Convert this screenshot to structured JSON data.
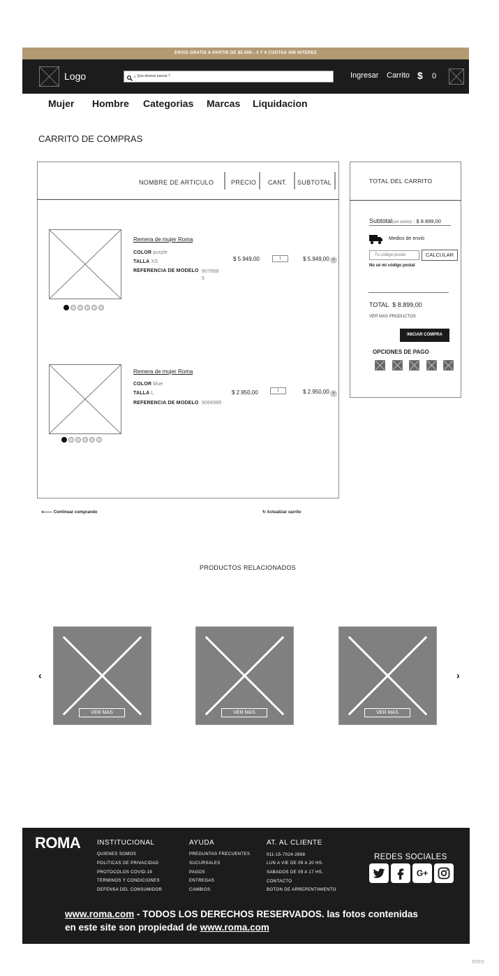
{
  "promo_bar": {
    "text": "ENVIO GRATIS A PARTIR DE $5.000.- 3 Y 6 CUOTAS SIN INTERES"
  },
  "header": {
    "logo_label": "Logo",
    "search_placeholder": "¿ Que deseas buscar ?",
    "login_label": "Ingresar",
    "cart_label": "Carrito",
    "cart_currency": "$",
    "cart_count": "0"
  },
  "nav": {
    "items": [
      "Mujer",
      "Hombre",
      "Categorias",
      "Marcas",
      "Liquidacion"
    ]
  },
  "page_title": "CARRITO DE COMPRAS",
  "cart_table": {
    "columns": [
      "NOMBRE DE ARTICULO",
      "PRECIO",
      "CANT.",
      "SUBTOTAL"
    ],
    "items": [
      {
        "name": "Remera de mujer Roma",
        "color_label": "COLOR",
        "color_value": "purple",
        "size_label": "TALLA",
        "size_value": "XS",
        "ref_label": "REFERENCIA DE MODELO",
        "ref_value": "907668",
        "ref_value_2": "5",
        "price": "$ 5.949,00",
        "qty": "1",
        "subtotal": "$ 5.949,00"
      },
      {
        "name": "Remera de mujer Roma",
        "color_label": "COLOR",
        "color_value": "blue",
        "size_label": "TALLA",
        "size_value": "L",
        "ref_label": "REFERENCIA DE MODELO",
        "ref_value": "9066985",
        "price": "$ 2.950,00",
        "qty": "1",
        "subtotal": "$ 2.950,00"
      }
    ],
    "continue_label": "Continuar comprando",
    "update_label": "Actualizar carrito"
  },
  "cart_total": {
    "title": "TOTAL DEL CARRITO",
    "subtotal_label": "Subtotal",
    "subtotal_note": "(sin envío)",
    "subtotal_value": ": $ 8.899,00",
    "shipping_label": "Medios de envió",
    "postal_placeholder": "Tu código postal",
    "calc_label": "CALCULAR",
    "postal_help": "No sé mi código postal",
    "total_label": "TOTAL",
    "total_value": "$ 8.899,00",
    "more_products": "VER MAS PRODUCTOS",
    "checkout_label": "INICIAR COMPRA",
    "payment_title": "OPCIONES DE PAGO",
    "payment_icons": [
      "payment-icon-1",
      "payment-icon-2",
      "payment-icon-3",
      "payment-icon-4",
      "payment-icon-5"
    ]
  },
  "related": {
    "title": "PRODUCTOS RELACIONADOS",
    "cards": [
      {
        "button": "VER MAS"
      },
      {
        "button": "VER MAS"
      },
      {
        "button": "VER MAS"
      }
    ],
    "prev_icon": "‹",
    "next_icon": "›"
  },
  "footer": {
    "brand": "ROMA",
    "columns": [
      {
        "title": "INSTITUCIONAL",
        "links": [
          "QUIENES SOMOS",
          "POLITICAS DE PRIVACIDAD",
          "PROTOCOLOS COVID-19",
          "TERMINOS Y CONDICIONES",
          "DEFENSA DEL CONSUMIDOR"
        ]
      },
      {
        "title": "AYUDA",
        "links": [
          "PREGUNTAS FRECUENTES",
          "SUCURSALES",
          "PAGOS",
          "ENTREGAS",
          "CAMBIOS"
        ]
      },
      {
        "title": "AT. AL CLIENTE",
        "links": [
          "011-15-7024-2868",
          "LUN A VIE DE 09 A 20 HS.",
          "SABADOS DE 09 A 17 HS.",
          "CONTACTO",
          "BOTON DE ARREPENTIMIENTO"
        ]
      }
    ],
    "social_title": "REDES SOCIALES",
    "social_icons": [
      "twitter-icon",
      "facebook-icon",
      "google-plus-icon",
      "instagram-icon"
    ],
    "copyright_link": "www.roma.com",
    "copyright_text_1": " - TODOS LOS DERECHOS RESERVADOS. las fotos contenidas",
    "copyright_text_2": "en este site son propiedad de ",
    "copyright_link_2": "www.roma.com"
  },
  "watermark": "miro"
}
